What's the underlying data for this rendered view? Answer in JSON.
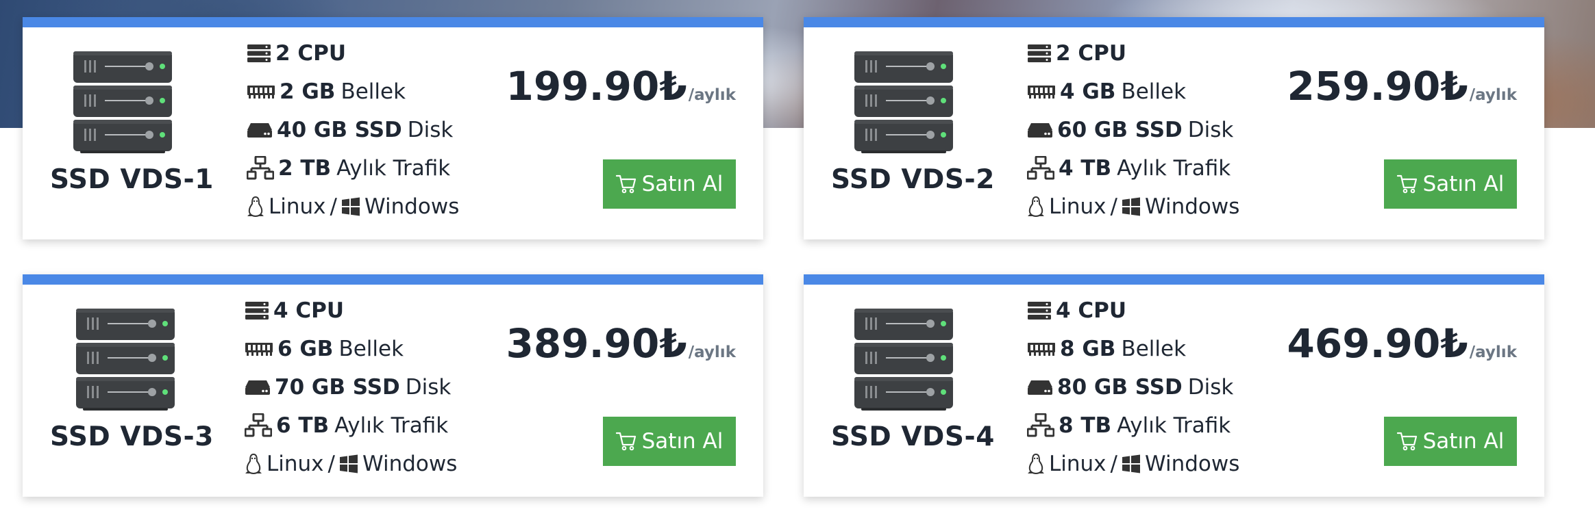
{
  "colors": {
    "accent_bar": "#4a88e6",
    "button_bg": "#4ca84f",
    "text": "#1f2733",
    "muted": "#6b7683"
  },
  "plans": [
    {
      "name": "SSD VDS-1",
      "cpu_value": "2 CPU",
      "ram_value": "2 GB",
      "ram_label": "Bellek",
      "disk_value": "40 GB SSD",
      "disk_label": "Disk",
      "traffic_value": "2 TB",
      "traffic_label": "Aylık Trafik",
      "os_linux": "Linux",
      "os_separator": "/",
      "os_windows": "Windows",
      "price": "199.90₺",
      "period": "/aylık",
      "buy_label": "Satın Al"
    },
    {
      "name": "SSD VDS-2",
      "cpu_value": "2 CPU",
      "ram_value": "4 GB",
      "ram_label": "Bellek",
      "disk_value": "60 GB SSD",
      "disk_label": "Disk",
      "traffic_value": "4 TB",
      "traffic_label": "Aylık Trafik",
      "os_linux": "Linux",
      "os_separator": "/",
      "os_windows": "Windows",
      "price": "259.90₺",
      "period": "/aylık",
      "buy_label": "Satın Al"
    },
    {
      "name": "SSD VDS-3",
      "cpu_value": "4 CPU",
      "ram_value": "6 GB",
      "ram_label": "Bellek",
      "disk_value": "70 GB SSD",
      "disk_label": "Disk",
      "traffic_value": "6 TB",
      "traffic_label": "Aylık Trafik",
      "os_linux": "Linux",
      "os_separator": "/",
      "os_windows": "Windows",
      "price": "389.90₺",
      "period": "/aylık",
      "buy_label": "Satın Al"
    },
    {
      "name": "SSD VDS-4",
      "cpu_value": "4 CPU",
      "ram_value": "8 GB",
      "ram_label": "Bellek",
      "disk_value": "80 GB SSD",
      "disk_label": "Disk",
      "traffic_value": "8 TB",
      "traffic_label": "Aylık Trafik",
      "os_linux": "Linux",
      "os_separator": "/",
      "os_windows": "Windows",
      "price": "469.90₺",
      "period": "/aylık",
      "buy_label": "Satın Al"
    }
  ]
}
